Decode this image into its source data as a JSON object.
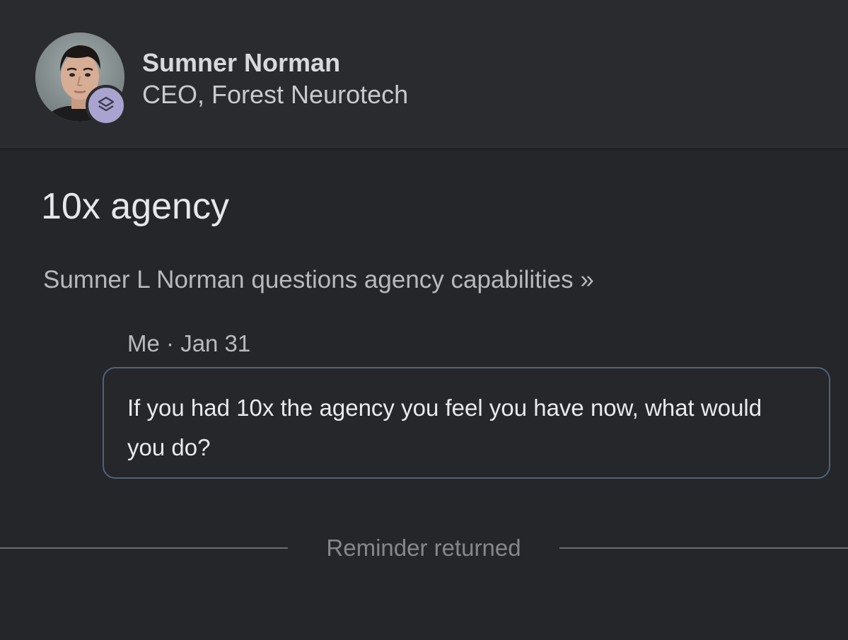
{
  "header": {
    "name": "Sumner Norman",
    "subtitle": "CEO, Forest Neurotech",
    "avatar_icon": "profile-photo",
    "badge_icon": "layers-icon",
    "badge_color": "#a9a3cf"
  },
  "main": {
    "title": "10x agency",
    "summary_link": "Sumner L Norman questions agency capabilities »",
    "note": {
      "author": "Me",
      "separator": "·",
      "date": "Jan 31",
      "text": "If you had 10x the agency you feel you have now, what would you do?"
    },
    "divider_label": "Reminder returned"
  },
  "colors": {
    "background": "#252629",
    "header_background": "#2a2b2f",
    "note_border": "#51627d"
  }
}
